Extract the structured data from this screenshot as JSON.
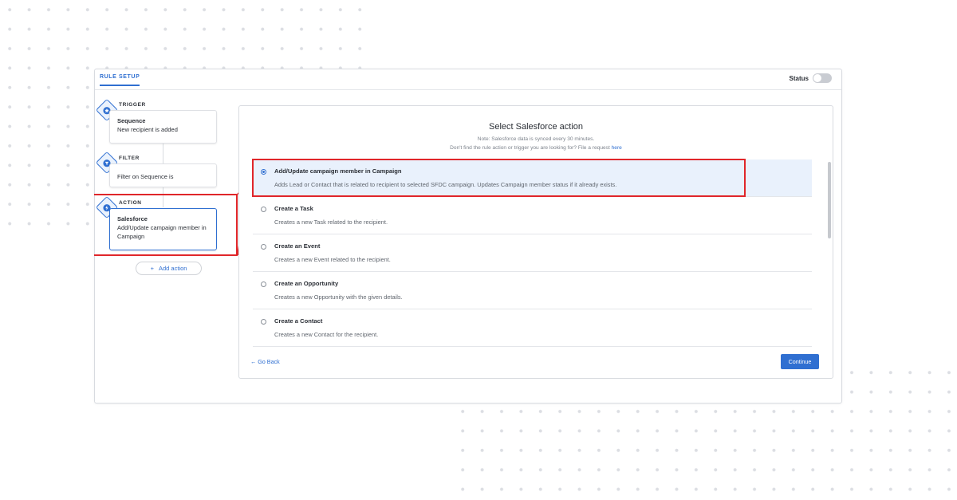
{
  "header": {
    "tab_label": "RULE SETUP",
    "status_label": "Status"
  },
  "workflow": {
    "trigger": {
      "label": "TRIGGER",
      "title": "Sequence",
      "subtitle": "New recipient is added"
    },
    "filter": {
      "label": "FILTER",
      "subtitle": "Filter on Sequence is"
    },
    "action": {
      "label": "ACTION",
      "title": "Salesforce",
      "subtitle": "Add/Update campaign member in Campaign"
    },
    "add_action_label": "Add action"
  },
  "panel": {
    "title": "Select Salesforce action",
    "note": "Note: Salesforce data is synced every 30 minutes.",
    "request_text": "Don't find the rule action or trigger you are looking for? File a request",
    "request_link": "here",
    "options": [
      {
        "title": "Add/Update campaign member in Campaign",
        "desc": "Adds Lead or Contact that is related to recipient to selected SFDC campaign. Updates Campaign member status if it already exists."
      },
      {
        "title": "Create a Task",
        "desc": "Creates a new Task related to the recipient."
      },
      {
        "title": "Create an Event",
        "desc": "Creates a new Event related to the recipient."
      },
      {
        "title": "Create an Opportunity",
        "desc": "Creates a new Opportunity with the given details."
      },
      {
        "title": "Create a Contact",
        "desc": "Creates a new Contact for the recipient."
      }
    ],
    "go_back_label": "Go Back",
    "continue_label": "Continue"
  },
  "colors": {
    "accent": "#2f6fd1",
    "highlight": "#e0262a",
    "selected_bg": "#e9f1fc"
  }
}
